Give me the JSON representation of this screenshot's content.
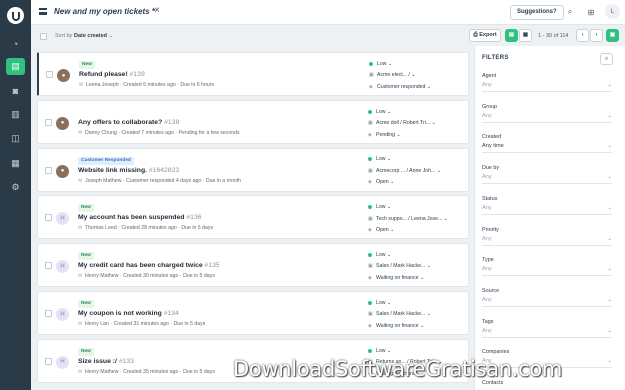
{
  "header": {
    "view_title": "New and my open tickets *",
    "close_icon": "×",
    "suggestions_label": "Suggestions?",
    "avatar_initial": "L"
  },
  "toolbar": {
    "sort_prefix": "Sort by",
    "sort_value": "Date created",
    "export_label": "Export",
    "pager_text": "1 - 30 of 114"
  },
  "colors": {
    "accent": "#2ec27e",
    "rail": "#2a3b47",
    "low_priority": "#2ec27e"
  },
  "tickets": [
    {
      "tag": "New",
      "tag_type": "new",
      "avatar": "photo-f",
      "subject": "Refund please!",
      "num": "#139",
      "requester": "Leena Joseph",
      "created": "Created 6 minutes ago",
      "due": "Due in 6 hours",
      "priority": "Low",
      "group": "Acme elect... /",
      "status": "Customer responded",
      "selected": true
    },
    {
      "tag": "",
      "tag_type": "",
      "avatar": "photo-m",
      "subject": "Any offers to collaborate?",
      "num": "#138",
      "requester": "Danny Chung",
      "created": "Created 7 minutes ago",
      "due": "Pending for a few seconds",
      "priority": "Low",
      "group": "Acme doll / Robert Tri...",
      "status": "Pending",
      "selected": false
    },
    {
      "tag": "Customer Responded",
      "tag_type": "resp",
      "avatar": "photo-j",
      "subject": "Website link missing.",
      "num": "#1642823",
      "requester": "Joseph Mathew",
      "created": "Customer responded 4 days ago",
      "due": "Due in a month",
      "priority": "Low",
      "group": "Acmecorp ... / Anne Joh...",
      "status": "Open",
      "selected": false
    },
    {
      "tag": "New",
      "tag_type": "new",
      "avatar": "H",
      "subject": "My account has been suspended",
      "num": "#136",
      "requester": "Thomas Leed",
      "created": "Created 28 minutes ago",
      "due": "Due in 5 days",
      "priority": "Low",
      "group": "Tech suppo... / Leena Jose...",
      "status": "Open",
      "selected": false
    },
    {
      "tag": "New",
      "tag_type": "new",
      "avatar": "H",
      "subject": "My credit card has been charged twice",
      "num": "#135",
      "requester": "Henry Mathew",
      "created": "Created 30 minutes ago",
      "due": "Due in 5 days",
      "priority": "Low",
      "group": "Sales / Mark Hacke...",
      "status": "Waiting on finance",
      "selected": false
    },
    {
      "tag": "New",
      "tag_type": "new",
      "avatar": "H",
      "subject": "My coupon is not working",
      "num": "#134",
      "requester": "Henry Lan",
      "created": "Created 31 minutes ago",
      "due": "Due in 5 days",
      "priority": "Low",
      "group": "Sales / Mark Hacke...",
      "status": "Waiting on finance",
      "selected": false
    },
    {
      "tag": "New",
      "tag_type": "new",
      "avatar": "H",
      "subject": "Size issue :/",
      "num": "#133",
      "requester": "Henry Mathew",
      "created": "Created 35 minutes ago",
      "due": "Due in 5 days",
      "priority": "Low",
      "group": "Returns an... / Robert Tri...",
      "status": "Waiting on finance",
      "selected": false
    }
  ],
  "filters": {
    "title": "FILTERS",
    "fields": [
      {
        "label": "Agent",
        "value": "Any"
      },
      {
        "label": "Group",
        "value": "Any"
      },
      {
        "label": "Created",
        "value": "Any time"
      },
      {
        "label": "Due by",
        "value": "Any"
      },
      {
        "label": "Status",
        "value": "Any"
      },
      {
        "label": "Priority",
        "value": "Any"
      },
      {
        "label": "Type",
        "value": "Any"
      },
      {
        "label": "Source",
        "value": "Any"
      },
      {
        "label": "Tags",
        "value": "Any"
      },
      {
        "label": "Companies",
        "value": "Any"
      },
      {
        "label": "Contacts",
        "value": ""
      }
    ]
  },
  "watermark": "DownloadSoftwareGratisan.com"
}
